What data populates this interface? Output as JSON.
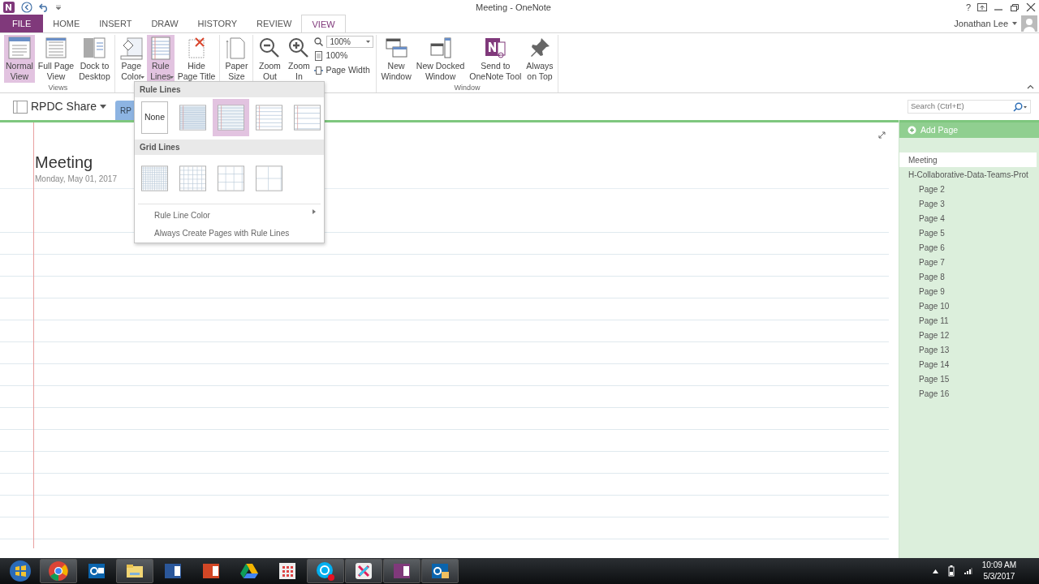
{
  "window": {
    "title": "Meeting - OneNote",
    "help": "?"
  },
  "tabs": [
    {
      "label": "FILE",
      "kind": "file",
      "selected": false
    },
    {
      "label": "HOME",
      "kind": "tab",
      "selected": false
    },
    {
      "label": "INSERT",
      "kind": "tab",
      "selected": false
    },
    {
      "label": "DRAW",
      "kind": "tab",
      "selected": false
    },
    {
      "label": "HISTORY",
      "kind": "tab",
      "selected": false
    },
    {
      "label": "REVIEW",
      "kind": "tab",
      "selected": false
    },
    {
      "label": "VIEW",
      "kind": "tab",
      "selected": true
    }
  ],
  "user": {
    "name": "Jonathan Lee"
  },
  "ribbon": [
    {
      "label": "Views",
      "items": [
        {
          "kind": "large",
          "lines": [
            "Normal",
            "View"
          ],
          "selected": true,
          "menu": false
        },
        {
          "kind": "large",
          "lines": [
            "Full Page",
            "View"
          ],
          "selected": false,
          "menu": false
        },
        {
          "kind": "large",
          "lines": [
            "Dock to",
            "Desktop"
          ],
          "selected": false,
          "menu": false
        }
      ]
    },
    {
      "items": [
        {
          "kind": "large",
          "lines": [
            "Page",
            "Color"
          ],
          "selected": false,
          "menu": true
        },
        {
          "kind": "large",
          "lines": [
            "Rule",
            "Lines"
          ],
          "selected": true,
          "menu": true
        },
        {
          "kind": "large",
          "lines": [
            "Hide",
            "Page Title"
          ],
          "selected": false,
          "menu": false
        }
      ]
    },
    {
      "items": [
        {
          "kind": "large",
          "lines": [
            "Paper",
            "Size"
          ],
          "selected": false,
          "menu": false
        }
      ]
    },
    {
      "items": [
        {
          "kind": "large",
          "lines": [
            "Zoom",
            "Out"
          ],
          "selected": false,
          "menu": false
        },
        {
          "kind": "large",
          "lines": [
            "Zoom",
            "In"
          ],
          "selected": false,
          "menu": false
        },
        {
          "kind": "stack",
          "rows": [
            {
              "kind": "select",
              "value": "100%"
            },
            {
              "kind": "button",
              "label": "100%"
            },
            {
              "kind": "button",
              "label": "Page Width"
            }
          ]
        }
      ]
    },
    {
      "label": "Window",
      "items": [
        {
          "kind": "large",
          "lines": [
            "New",
            "Window"
          ],
          "selected": false,
          "menu": false
        },
        {
          "kind": "large",
          "lines": [
            "New Docked",
            "Window"
          ],
          "selected": false,
          "menu": false
        },
        {
          "kind": "large",
          "lines": [
            "Send to",
            "OneNote Tool"
          ],
          "selected": false,
          "menu": false
        },
        {
          "kind": "large",
          "lines": [
            "Always",
            "on Top"
          ],
          "selected": false,
          "menu": false
        }
      ]
    }
  ],
  "notebook": {
    "name": "RPDC Share",
    "section_tab": "RP"
  },
  "search": {
    "placeholder": "Search (Ctrl+E)"
  },
  "page": {
    "title": "Meeting",
    "date": "Monday, May 01, 2017"
  },
  "rule_menu": {
    "rule_header": "Rule Lines",
    "rule_options": [
      {
        "kind": "none",
        "label": "None",
        "selected": false
      },
      {
        "kind": "college",
        "selected": false
      },
      {
        "kind": "narrow",
        "selected": true
      },
      {
        "kind": "standard",
        "selected": false
      },
      {
        "kind": "wide",
        "selected": false
      }
    ],
    "grid_header": "Grid Lines",
    "grid_options": [
      {
        "kind": "small",
        "selected": false
      },
      {
        "kind": "medium",
        "selected": false
      },
      {
        "kind": "large",
        "selected": false
      },
      {
        "kind": "xlarge",
        "selected": false
      }
    ],
    "items": [
      {
        "label": "Rule Line Color",
        "submenu": true
      },
      {
        "label": "Always Create Pages with Rule Lines",
        "submenu": false
      }
    ]
  },
  "pages_panel": {
    "add_page": "Add Page",
    "pages": [
      {
        "title": "Meeting",
        "selected": true
      },
      {
        "title": "H-Collaborative-Data-Teams-Prot",
        "selected": false,
        "children": [
          {
            "title": "Page 2",
            "selected": false
          },
          {
            "title": "Page 3",
            "selected": false
          },
          {
            "title": "Page 4",
            "selected": false
          },
          {
            "title": "Page 5",
            "selected": false
          },
          {
            "title": "Page 6",
            "selected": false
          },
          {
            "title": "Page 7",
            "selected": false
          },
          {
            "title": "Page 8",
            "selected": false
          },
          {
            "title": "Page 9",
            "selected": false
          },
          {
            "title": "Page 10",
            "selected": false
          },
          {
            "title": "Page 11",
            "selected": false
          },
          {
            "title": "Page 12",
            "selected": false
          },
          {
            "title": "Page 13",
            "selected": false
          },
          {
            "title": "Page 14",
            "selected": false
          },
          {
            "title": "Page 15",
            "selected": false
          },
          {
            "title": "Page 16",
            "selected": false
          }
        ]
      }
    ]
  },
  "taskbar": {
    "apps": [
      {
        "kind": "start",
        "running": false
      },
      {
        "kind": "chrome",
        "running": true
      },
      {
        "kind": "outlook",
        "running": false
      },
      {
        "kind": "explorer",
        "running": true
      },
      {
        "kind": "word",
        "running": false
      },
      {
        "kind": "powerpoint",
        "running": false
      },
      {
        "kind": "drive",
        "running": false
      },
      {
        "kind": "apps",
        "running": false
      },
      {
        "kind": "skype",
        "running": true
      },
      {
        "kind": "slack",
        "running": true
      },
      {
        "kind": "onenote",
        "running": true
      },
      {
        "kind": "outlook-mail",
        "running": true
      }
    ],
    "time": "10:09 AM",
    "date": "5/3/2017"
  }
}
